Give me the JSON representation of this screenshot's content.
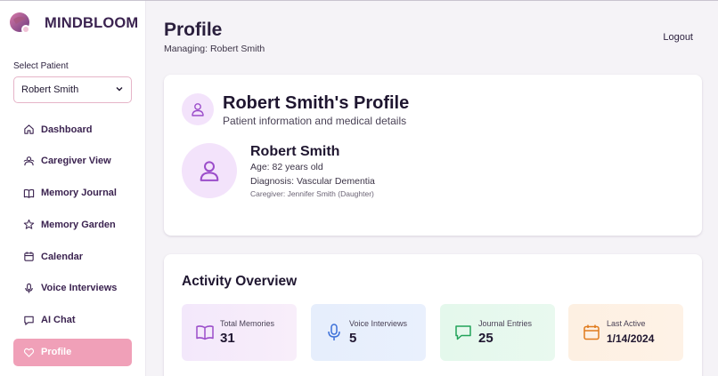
{
  "brand": {
    "name": "MINDBLOOM"
  },
  "sidebar": {
    "select_label": "Select Patient",
    "selected_patient": "Robert Smith",
    "items": [
      {
        "label": "Dashboard",
        "icon": "home-icon"
      },
      {
        "label": "Caregiver View",
        "icon": "users-icon"
      },
      {
        "label": "Memory Journal",
        "icon": "book-icon"
      },
      {
        "label": "Memory Garden",
        "icon": "star-icon"
      },
      {
        "label": "Calendar",
        "icon": "calendar-icon"
      },
      {
        "label": "Voice Interviews",
        "icon": "mic-icon"
      },
      {
        "label": "AI Chat",
        "icon": "chat-icon"
      },
      {
        "label": "Profile",
        "icon": "heart-icon",
        "active": true
      }
    ]
  },
  "header": {
    "title": "Profile",
    "subtitle": "Managing: Robert Smith",
    "logout_label": "Logout"
  },
  "profile": {
    "title": "Robert Smith's Profile",
    "subtitle": "Patient information and medical details",
    "name": "Robert Smith",
    "age": "Age: 82 years old",
    "diagnosis": "Diagnosis: Vascular Dementia",
    "caregiver": "Caregiver: Jennifer Smith (Daughter)"
  },
  "activity": {
    "title": "Activity Overview",
    "stats": [
      {
        "label": "Total Memories",
        "value": "31",
        "icon": "book-icon",
        "color": "#9b4dca"
      },
      {
        "label": "Voice Interviews",
        "value": "5",
        "icon": "mic-icon",
        "color": "#3b6fd8"
      },
      {
        "label": "Journal Entries",
        "value": "25",
        "icon": "chat-icon",
        "color": "#22a35a"
      },
      {
        "label": "Last Active",
        "value": "1/14/2024",
        "icon": "calendar-icon",
        "color": "#e07a1c"
      }
    ]
  },
  "colors": {
    "accent": "#f0a0b8",
    "brand": "#3b2350"
  }
}
